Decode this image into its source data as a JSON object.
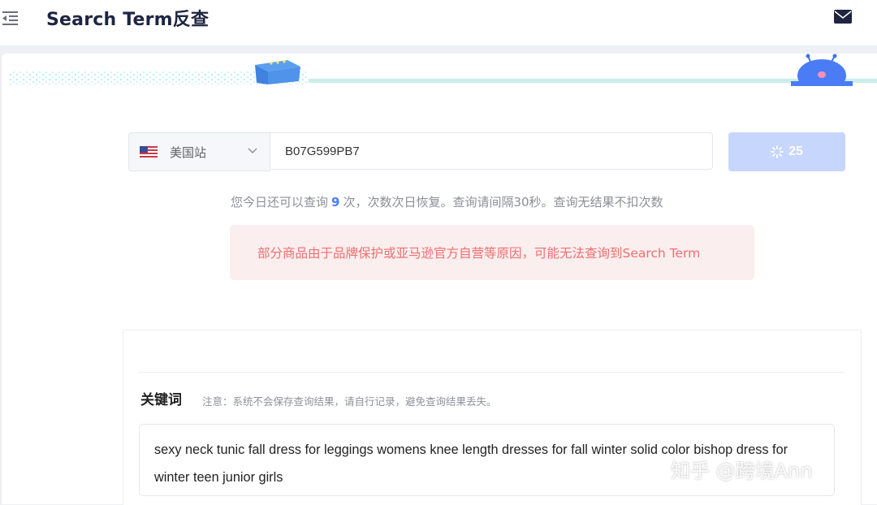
{
  "header": {
    "title": "Search Term反查",
    "collapse_icon": "menu-collapse-icon",
    "mail_icon": "mail-icon"
  },
  "search": {
    "site_flag": "us-flag-icon",
    "site_label": "美国站",
    "asin_value": "B07G599PB7",
    "button_label": "25",
    "button_icon": "loading-spinner-icon"
  },
  "quota": {
    "prefix": "您今日还可以查询",
    "count": "9",
    "suffix": "次，次数次日恢复。查询请间隔30秒。查询无结果不扣次数"
  },
  "notice": {
    "text": "部分商品由于品牌保护或亚马逊官方自营等原因，可能无法查询到Search Term"
  },
  "result": {
    "heading": "关键词",
    "note": "注意：系统不会保存查询结果，请自行记录，避免查询结果丢失。",
    "keywords": "sexy neck tunic fall dress for leggings womens knee length dresses for fall winter solid color bishop dress for winter teen junior girls"
  },
  "watermark": "知乎 @跨境Ann",
  "colors": {
    "title": "#1f2540",
    "button_disabled": "#c7d6fd",
    "warning_bg": "#fbeeee",
    "warning_text": "#ee6f71",
    "quota_count": "#4a7cf5"
  }
}
